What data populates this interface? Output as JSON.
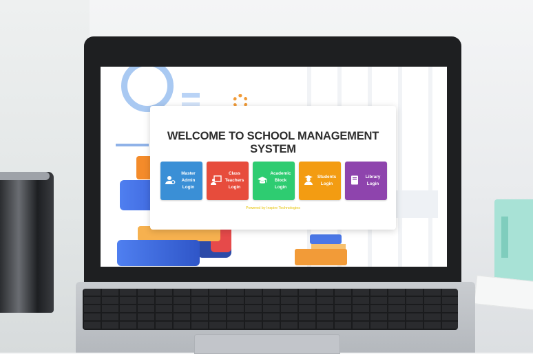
{
  "page": {
    "title": "WELCOME TO SCHOOL MANAGEMENT SYSTEM",
    "footer": "Powered by Inspire Technologies"
  },
  "logins": [
    {
      "id": "master-admin",
      "label": "Master\nAdmin\nLogin",
      "color": "#3a8fd6",
      "icon": "admin-user-icon"
    },
    {
      "id": "class-teachers",
      "label": "Class\nTeachers\nLogin",
      "color": "#e74c3c",
      "icon": "teacher-board-icon"
    },
    {
      "id": "academic-block",
      "label": "Academic\nBlock\nLogin",
      "color": "#2ecc71",
      "icon": "graduation-cap-icon"
    },
    {
      "id": "students",
      "label": "Students\nLogin",
      "color": "#f39c12",
      "icon": "student-icon"
    },
    {
      "id": "library",
      "label": "Library\nLogin",
      "color": "#8e44ad",
      "icon": "book-icon"
    }
  ]
}
